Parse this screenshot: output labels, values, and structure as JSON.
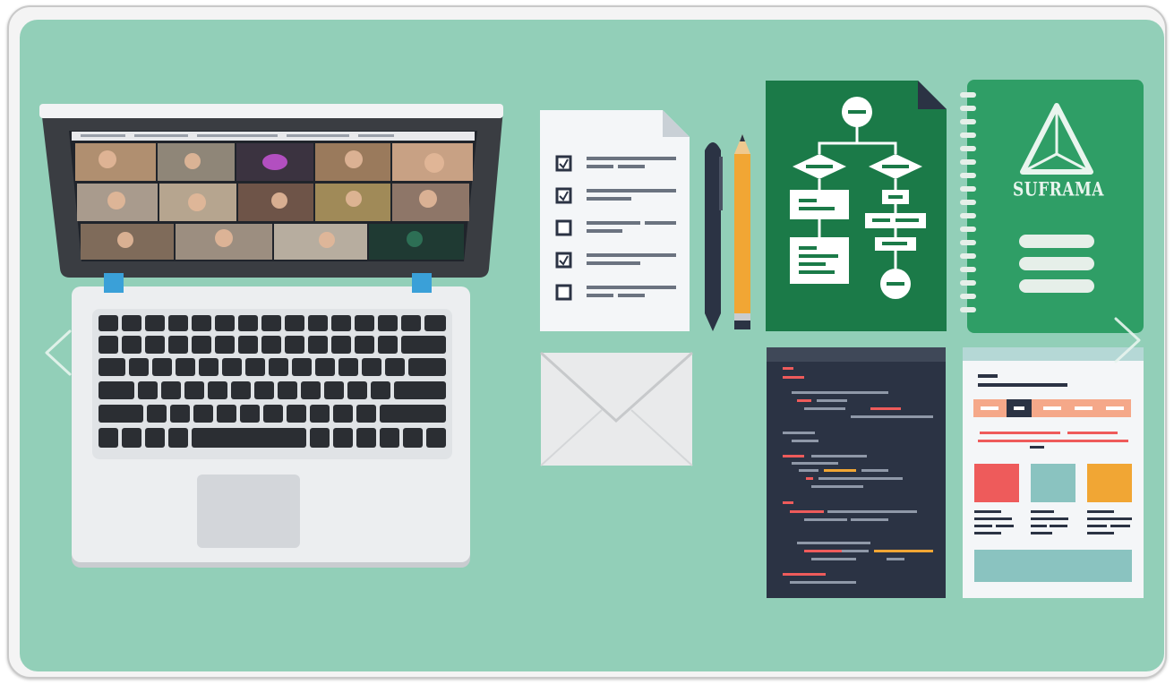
{
  "carousel": {
    "prev_icon": "chevron-left-icon",
    "next_icon": "chevron-right-icon"
  },
  "notebook": {
    "logo_text": "SUFRAMA",
    "logo_icon": "triangle-logo-icon"
  },
  "colors": {
    "background": "#92cfb8",
    "dark_green": "#1b7a48",
    "mid_green": "#2f9e66",
    "navy": "#2b3344",
    "accent_red": "#ee5b5b",
    "accent_orange": "#f1a634",
    "accent_teal": "#8ac3c0"
  }
}
